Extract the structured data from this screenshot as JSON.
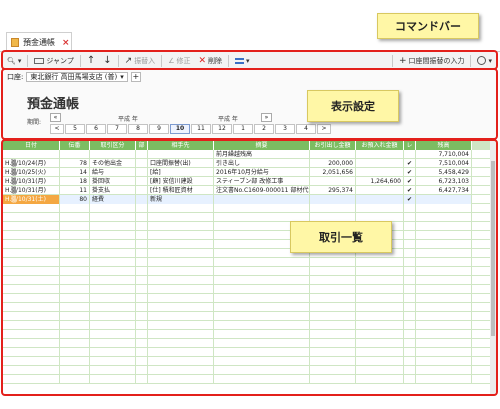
{
  "tab": {
    "title": "預金通帳",
    "close": "×"
  },
  "toolbar": {
    "jump": "ジャンプ",
    "copy": "振替入",
    "edit": "修正",
    "delete": "削除",
    "transfer": "口座間振替の入力"
  },
  "settings": {
    "account_label": "口座:",
    "account_value": "東北銀行 高田馬場支店 (普)",
    "title": "預金通帳",
    "period_label": "期間:",
    "era_left": "平成  年",
    "era_right": "平成  年",
    "months": [
      "<",
      "5",
      "6",
      "7",
      "8",
      "9",
      "10",
      "11",
      "12",
      "1",
      "2",
      "3",
      "4",
      ">"
    ],
    "active_month": "10"
  },
  "grid": {
    "columns": [
      "日付",
      "伝番",
      "取引区分",
      "部",
      "相手先",
      "摘要",
      "お引出し金額",
      "お預入れ金額",
      "レ",
      "残高"
    ],
    "rows": [
      [
        "",
        "",
        "",
        "",
        "",
        "前月繰越残高",
        "",
        "",
        "",
        "7,710,004"
      ],
      [
        "H.▒/10/24(月)",
        "78",
        "その他出金",
        "",
        "口座間振替(出)",
        "引き出し",
        "200,000",
        "",
        "✔",
        "7,510,004"
      ],
      [
        "H.▒/10/25(火)",
        "14",
        "給与",
        "",
        "[給]",
        "2016年10月分給与",
        "2,051,656",
        "",
        "✔",
        "5,458,429"
      ],
      [
        "H.▒/10/31(月)",
        "18",
        "掛回収",
        "",
        "[顧] 安信川建設",
        "スティーブン部 改修工事",
        "",
        "1,264,600",
        "✔",
        "6,723,103"
      ],
      [
        "H.▒/10/31(月)",
        "11",
        "掛支払",
        "",
        "[仕] 積和匠資材",
        "注文書No.C1609-000011 部材代金",
        "295,374",
        "",
        "✔",
        "6,427,734"
      ],
      [
        "H.▒/10/31(土)",
        "80",
        "経費",
        "",
        "",
        "",
        "",
        "",
        "✔",
        ""
      ]
    ],
    "new_row_label": "新規"
  },
  "callouts": {
    "command_bar": "コマンドバー",
    "display_settings": "表示設定",
    "transaction_list": "取引一覧"
  }
}
